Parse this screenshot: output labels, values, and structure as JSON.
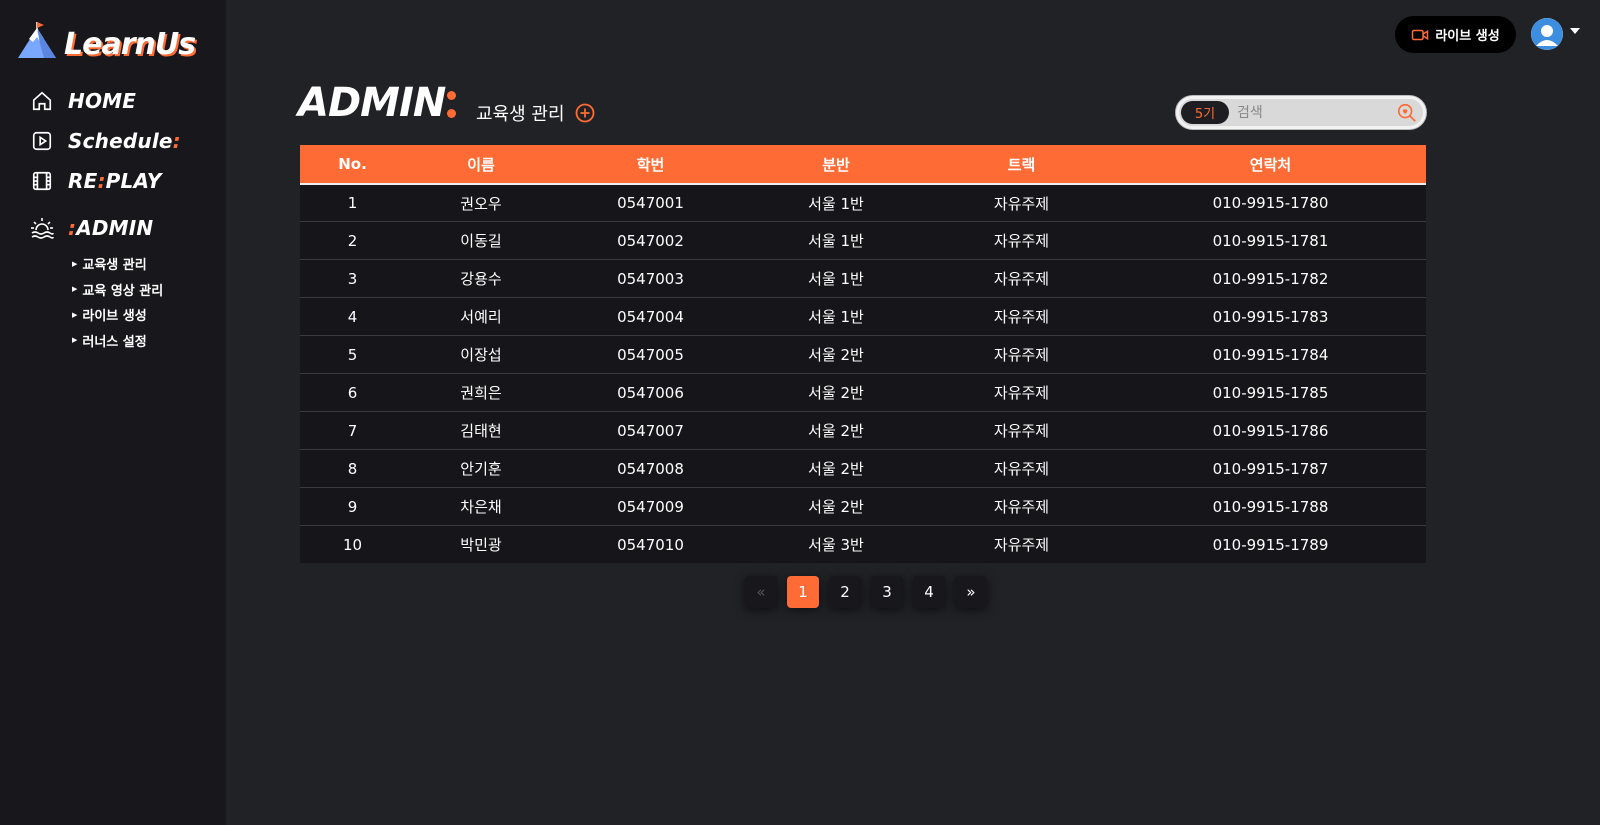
{
  "app": {
    "logo_text": "LearnUs",
    "accent_color": "#ff6b35"
  },
  "sidebar": {
    "nav": [
      {
        "label_pre": "HOME",
        "label_accent": "",
        "label_post": "",
        "icon": "home-icon"
      },
      {
        "label_pre": "Schedule",
        "label_accent": ":",
        "label_post": "",
        "icon": "play-square-icon"
      },
      {
        "label_pre": "RE",
        "label_accent": ":",
        "label_post": "PLAY",
        "icon": "film-icon"
      },
      {
        "label_pre": "",
        "label_accent": ":",
        "label_post": "ADMIN",
        "icon": "sunrise-icon"
      }
    ],
    "admin_sub": [
      "교육생 관리",
      "교육 영상 관리",
      "라이브 생성",
      "러너스 설정"
    ]
  },
  "topbar": {
    "live_button": "라이브 생성"
  },
  "page": {
    "heading": "ADMIN",
    "section_title": "교육생 관리"
  },
  "search": {
    "cohort": "5기",
    "placeholder": "검색"
  },
  "table": {
    "columns": [
      "No.",
      "이름",
      "학번",
      "분반",
      "트랙",
      "연락처"
    ],
    "rows": [
      [
        "1",
        "권오우",
        "0547001",
        "서울 1반",
        "자유주제",
        "010-9915-1780"
      ],
      [
        "2",
        "이동길",
        "0547002",
        "서울 1반",
        "자유주제",
        "010-9915-1781"
      ],
      [
        "3",
        "강용수",
        "0547003",
        "서울 1반",
        "자유주제",
        "010-9915-1782"
      ],
      [
        "4",
        "서예리",
        "0547004",
        "서울 1반",
        "자유주제",
        "010-9915-1783"
      ],
      [
        "5",
        "이장섭",
        "0547005",
        "서울 2반",
        "자유주제",
        "010-9915-1784"
      ],
      [
        "6",
        "권희은",
        "0547006",
        "서울 2반",
        "자유주제",
        "010-9915-1785"
      ],
      [
        "7",
        "김태현",
        "0547007",
        "서울 2반",
        "자유주제",
        "010-9915-1786"
      ],
      [
        "8",
        "안기훈",
        "0547008",
        "서울 2반",
        "자유주제",
        "010-9915-1787"
      ],
      [
        "9",
        "차은채",
        "0547009",
        "서울 2반",
        "자유주제",
        "010-9915-1788"
      ],
      [
        "10",
        "박민광",
        "0547010",
        "서울 3반",
        "자유주제",
        "010-9915-1789"
      ]
    ]
  },
  "pagination": {
    "prev": "«",
    "pages": [
      "1",
      "2",
      "3",
      "4"
    ],
    "next": "»",
    "current": "1"
  }
}
